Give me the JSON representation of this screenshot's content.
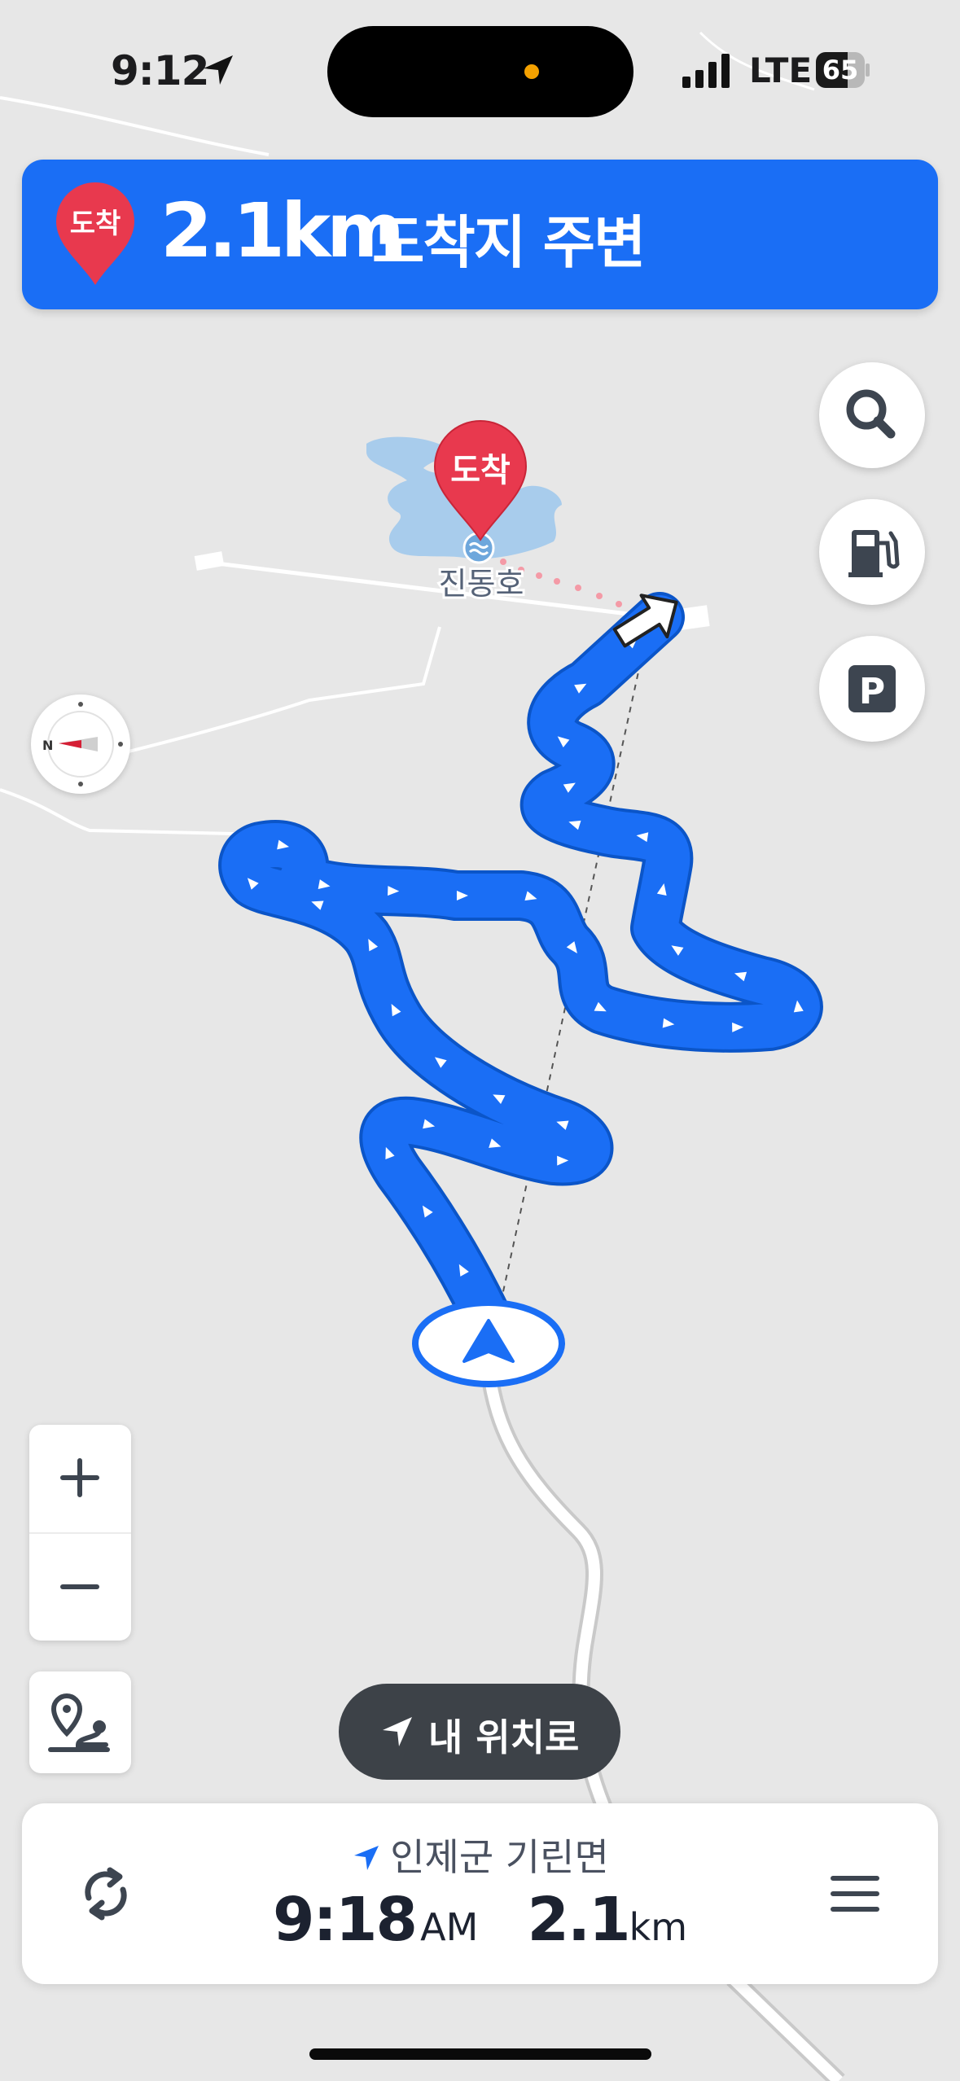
{
  "status_bar": {
    "time": "9:12",
    "network": "LTE",
    "battery_level": 65,
    "battery_label": "65"
  },
  "nav_banner": {
    "pin_label": "도착",
    "distance": "2.1km",
    "description": "도착지 주변"
  },
  "map": {
    "destination_pin_label": "도착",
    "lake_label": "진동호"
  },
  "controls": {
    "search_icon": "search-icon",
    "fuel_icon": "fuel-station-icon",
    "parking_label": "P",
    "zoom_in_icon": "plus-icon",
    "zoom_out_icon": "minus-icon",
    "route_overview_icon": "route-icon"
  },
  "my_location_button": {
    "label": "내 위치로"
  },
  "bottom_card": {
    "location": "인제군 기린면",
    "eta_time": "9:18",
    "eta_period": "AM",
    "remaining_distance": "2.1",
    "remaining_unit": "km"
  },
  "colors": {
    "route_blue": "#1a6ef5",
    "pin_red": "#e8394e",
    "map_bg": "#e7e7e7",
    "lake_blue": "#a8ccec"
  }
}
